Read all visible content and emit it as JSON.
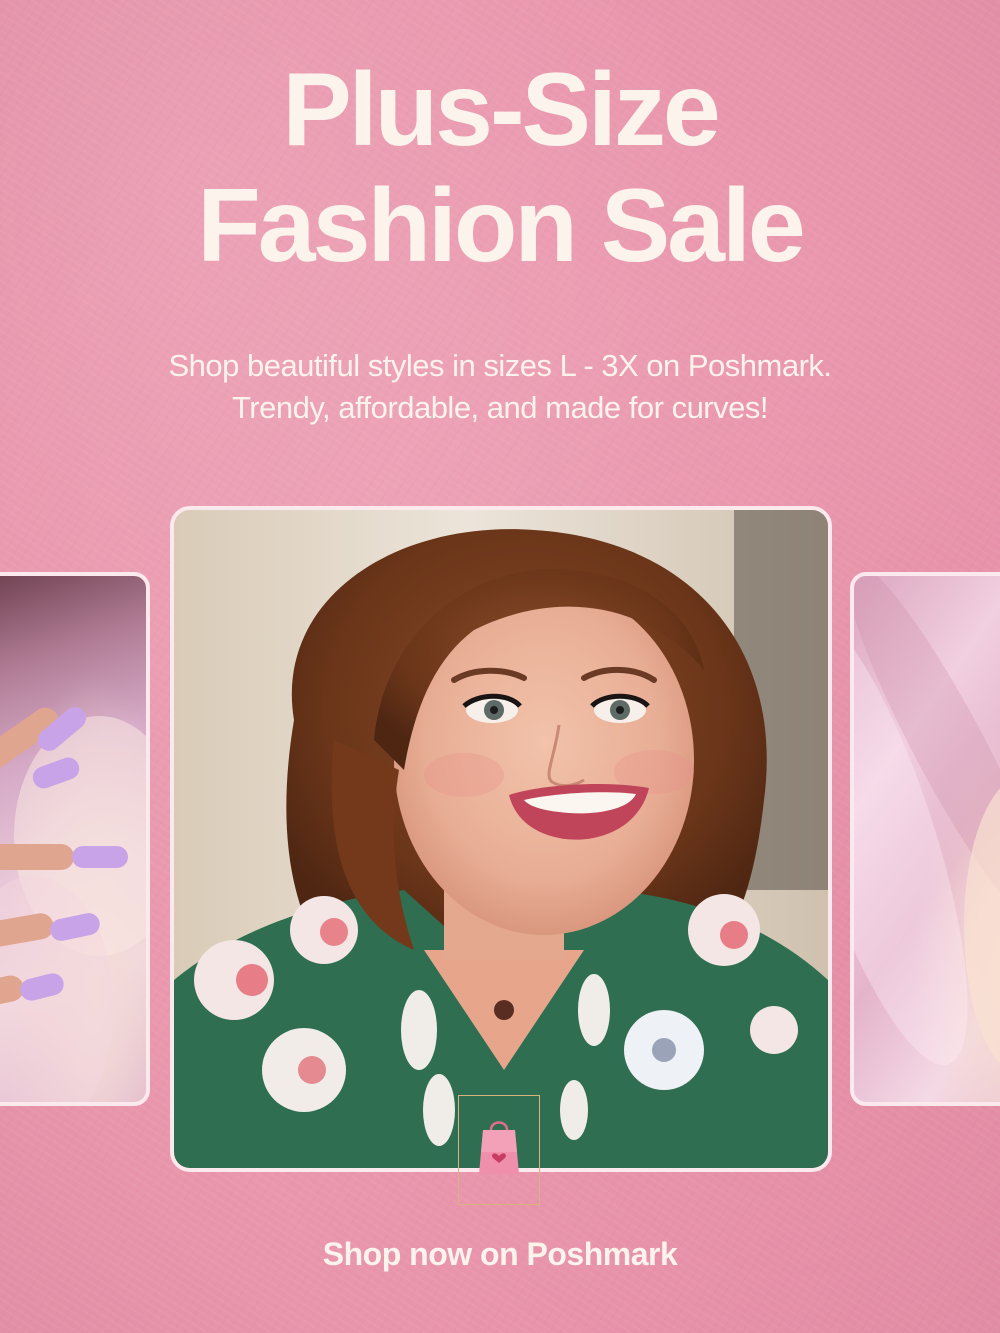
{
  "headline": {
    "line1": "Plus-Size",
    "line2": "Fashion Sale"
  },
  "subtitle": {
    "line1": "Shop beautiful styles in sizes L - 3X on Poshmark.",
    "line2": "Trendy, affordable, and made for curves!"
  },
  "images": {
    "left": "hands-with-lavender-nails-photo",
    "main": "smiling-woman-floral-top-photo",
    "right": "pink-satin-fabric-photo"
  },
  "icons": {
    "bag": "shopping-bag-icon"
  },
  "cta": {
    "label": "Shop now on Poshmark"
  },
  "colors": {
    "background": "#e996ac",
    "text": "#fbf3ec",
    "card_border": "#fbe9ee",
    "bag_frame": "#d8b37c"
  }
}
